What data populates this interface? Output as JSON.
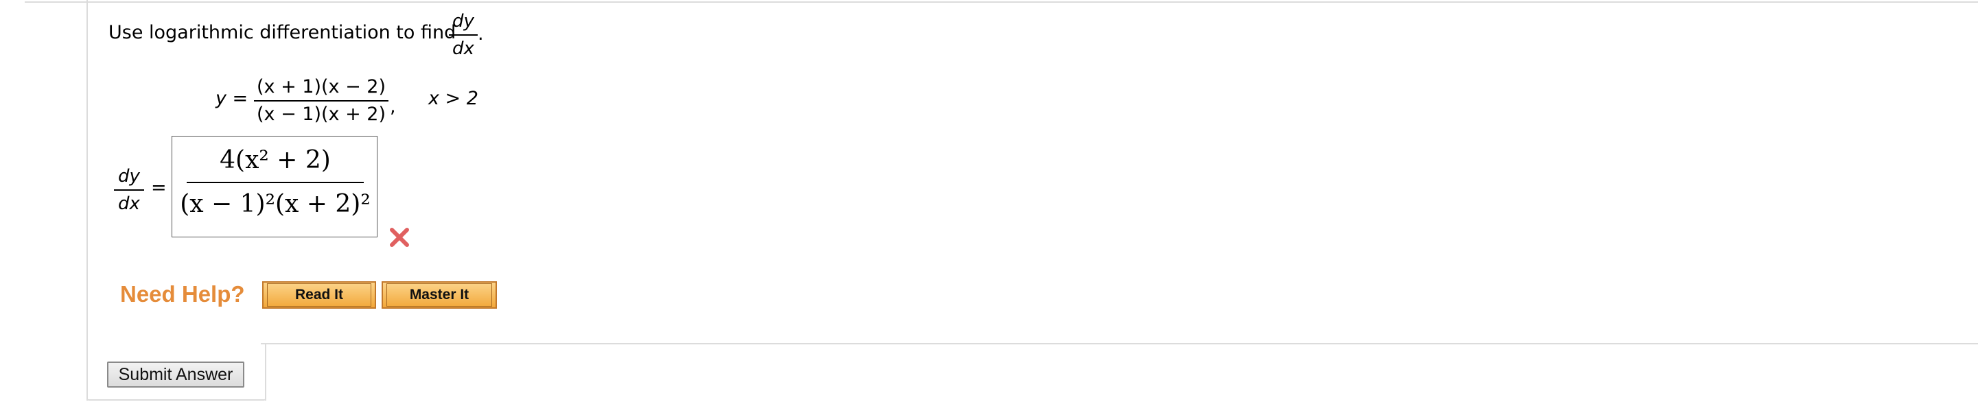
{
  "question": {
    "prompt": "Use logarithmic differentiation to find",
    "prompt_frac": {
      "num": "dy",
      "den": "dx"
    },
    "prompt_end": ".",
    "equation_lhs": "y =",
    "equation_num": "(x + 1)(x − 2)",
    "equation_den": "(x − 1)(x + 2)",
    "equation_comma": ",",
    "condition": "x > 2"
  },
  "answer": {
    "lhs_num": "dy",
    "lhs_den": "dx",
    "equals": "=",
    "num": "4(x² + 2)",
    "den": "(x − 1)²(x + 2)²",
    "status_icon": "incorrect-x-icon",
    "status_color": "#e06060"
  },
  "help": {
    "label": "Need Help?",
    "read_it": "Read It",
    "master_it": "Master It",
    "accent": "#e58c3a"
  },
  "submit": {
    "label": "Submit Answer"
  }
}
